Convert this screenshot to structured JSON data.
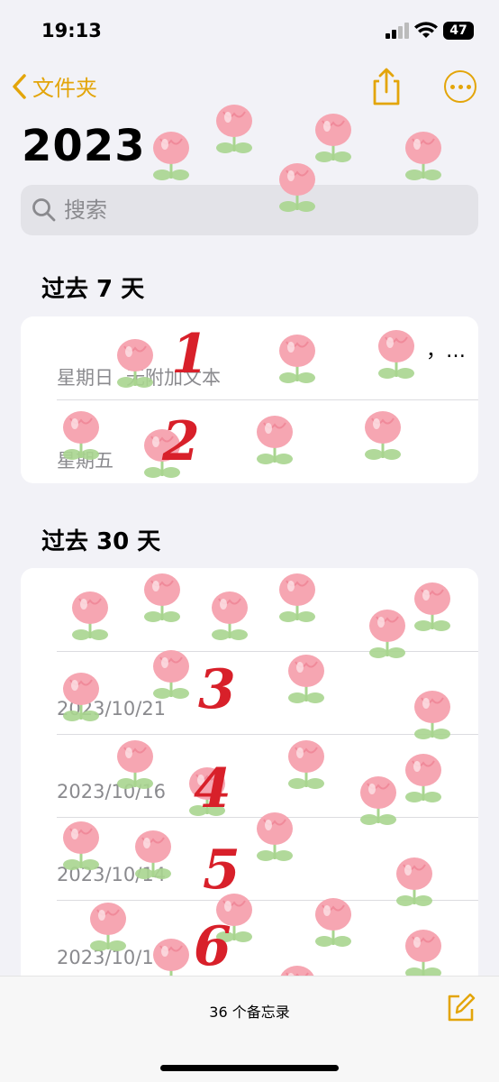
{
  "status": {
    "time": "19:13",
    "battery": "47"
  },
  "nav": {
    "back_label": "文件夹"
  },
  "page": {
    "title": "2023"
  },
  "search": {
    "placeholder": "搜索"
  },
  "sections": [
    {
      "header": "过去 7 天",
      "notes": [
        {
          "title": "，…",
          "date": "星期日",
          "preview": "无附加文本",
          "annotation": "1"
        },
        {
          "title": "",
          "date": "星期五",
          "preview": "",
          "annotation": "2"
        }
      ]
    },
    {
      "header": "过去 30 天",
      "notes": [
        {
          "title": "",
          "date": "",
          "preview": "",
          "annotation": ""
        },
        {
          "title": "",
          "date": "2023/10/21",
          "preview": "",
          "annotation": "3"
        },
        {
          "title": "",
          "date": "2023/10/16",
          "preview": "",
          "annotation": "4"
        },
        {
          "title": "",
          "date": "2023/10/14",
          "preview": "",
          "annotation": "5"
        },
        {
          "title": "",
          "date": "2023/10/14",
          "preview": "",
          "annotation": "6"
        }
      ]
    }
  ],
  "footer": {
    "note_count": "36 个备忘录"
  },
  "colors": {
    "accent": "#e3a50a",
    "annotation": "#d8202a",
    "flower_pink": "#f6a6b2",
    "leaf_green": "#a8d58f"
  }
}
